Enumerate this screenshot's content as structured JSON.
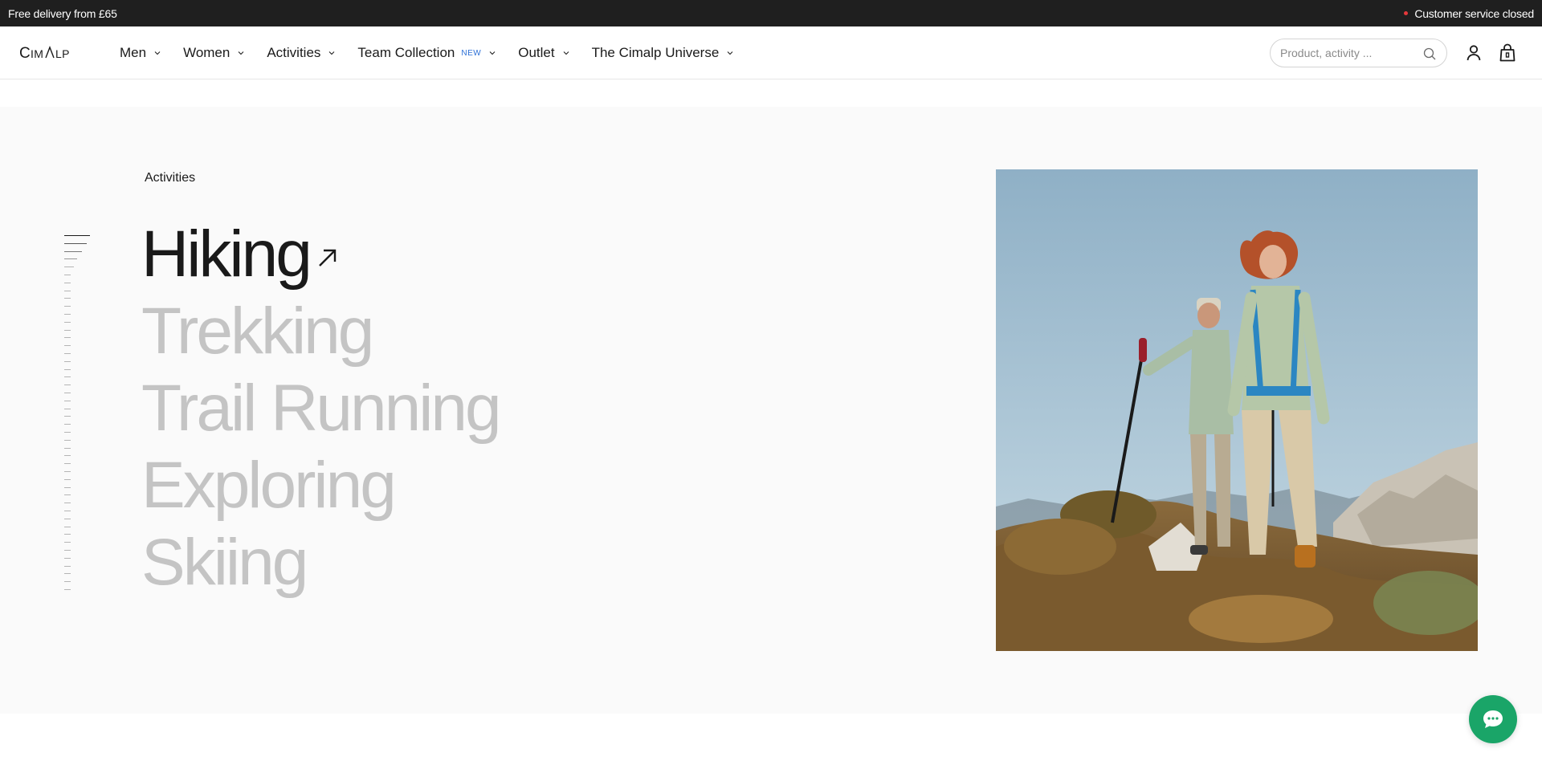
{
  "topbar": {
    "delivery_text": "Free delivery from £65",
    "service_status": "Customer service closed",
    "status_color": "#e5383b",
    "background": "#1f1f1f"
  },
  "header": {
    "logo_text": "CIMALP",
    "nav": [
      {
        "label": "Men"
      },
      {
        "label": "Women"
      },
      {
        "label": "Activities"
      },
      {
        "label": "Team Collection",
        "badge": "NEW"
      },
      {
        "label": "Outlet"
      },
      {
        "label": "The Cimalp Universe"
      }
    ],
    "search": {
      "placeholder": "Product, activity ..."
    },
    "icons": [
      "search-icon",
      "account-icon",
      "cart-icon",
      "chevron-down-icon"
    ]
  },
  "hero": {
    "section_label": "Activities",
    "activities": [
      {
        "label": "Hiking",
        "active": true
      },
      {
        "label": "Trekking",
        "active": false
      },
      {
        "label": "Trail Running",
        "active": false
      },
      {
        "label": "Exploring",
        "active": false
      },
      {
        "label": "Skiing",
        "active": false
      }
    ],
    "photo_alt": "Two hikers walking on a mountain ridge"
  },
  "chat": {
    "icon": "chat-icon",
    "color": "#1aa568"
  }
}
